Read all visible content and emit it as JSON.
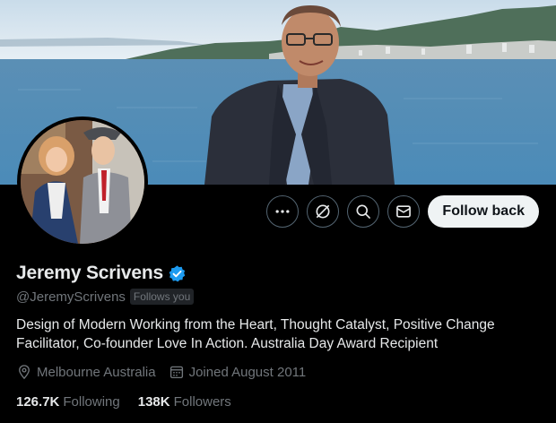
{
  "profile": {
    "display_name": "Jeremy Scrivens",
    "handle": "@JeremyScrivens",
    "follows_you": "Follows you",
    "bio": "Design of Modern Working from the Heart, Thought Catalyst, Positive Change Facilitator, Co-founder Love In Action. Australia Day Award Recipient",
    "location": "Melbourne Australia",
    "joined": "Joined August 2011",
    "following_count": "126.7K",
    "following_label": "Following",
    "followers_count": "138K",
    "followers_label": "Followers"
  },
  "actions": {
    "more_icon": "more-icon",
    "grok_icon": "grok-icon",
    "search_icon": "search-icon",
    "message_icon": "message-icon",
    "follow_back_label": "Follow back"
  },
  "colors": {
    "background": "#000000",
    "verified_blue": "#1d9bf0",
    "muted_text": "#71767b",
    "button_bg": "#eff3f4"
  }
}
